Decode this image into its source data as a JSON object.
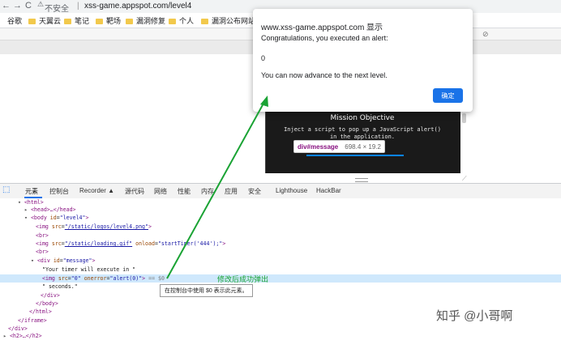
{
  "browser": {
    "nav_back": "←",
    "nav_forward": "→",
    "nav_reload": "C",
    "security_label": "不安全",
    "url": "xss-game.appspot.com/level4",
    "bookmarks": [
      "谷歌",
      "天翼云",
      "笔记",
      "靶场",
      "漏洞修复",
      "个人",
      "漏洞公布网站"
    ]
  },
  "alert": {
    "origin": "www.xss-game.appspot.com 显示",
    "message": "Congratulations, you executed an alert:",
    "value": "0",
    "next": "You can now advance to the next level.",
    "ok_label": "确定"
  },
  "game": {
    "mission_title": "Mission Objective",
    "mission_line1": "Inject a script to pop up a JavaScript alert()",
    "mission_line2": "in the application."
  },
  "inspector_tooltip": {
    "selector": "div#message",
    "size": "698.4 × 19.2"
  },
  "devtools": {
    "tabs": [
      "元素",
      "控制台",
      "Recorder ▲",
      "源代码",
      "网络",
      "性能",
      "内存",
      "应用",
      "安全",
      "Lighthouse",
      "HackBar"
    ],
    "active_tab": "元素",
    "hint": "在控制台中使用 $0 表示此元素。"
  },
  "dom": {
    "html_open": "<html>",
    "head": "<head>…</head>",
    "body_tag": "<body",
    "body_attr": "id",
    "body_val": "\"level4\"",
    "img1_tag": "<img",
    "img1_attr": "src",
    "img1_val": "\"/static/logos/level4.png\"",
    "br": "<br>",
    "img2_tag": "<img",
    "img2_attr": "src",
    "img2_val": "\"/static/loading.gif\"",
    "img2_attr2": "onload",
    "img2_val2": "\"startTimer('444');\"",
    "div_tag": "<div",
    "div_attr": "id",
    "div_val": "\"message\"",
    "timer_text": "\"Your timer will execute in \"",
    "sel_tag": "<img",
    "sel_attr1": "src",
    "sel_val1": "\"0\"",
    "sel_attr2": "onerror",
    "sel_val2": "\"alert(0)\"",
    "sel_suffix": "== $0",
    "seconds": "\" seconds.\"",
    "div_close": "</div>",
    "body_close": "</body>",
    "html_close": "</html>",
    "iframe_close": "</iframe>",
    "div_close2": "</div>",
    "h2": "<h2>…</h2>"
  },
  "annotation": "修改后成功弹出",
  "watermark": "知乎 @小哥啊",
  "colors": {
    "arrow": "#1aa334",
    "ok_button": "#1a73e8",
    "selected_row": "#cfe8fc"
  }
}
